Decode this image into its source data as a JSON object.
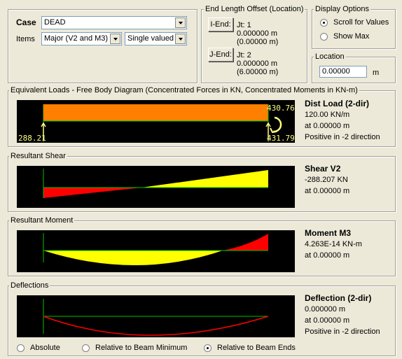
{
  "case": {
    "label": "Case",
    "value": "DEAD"
  },
  "items": {
    "label": "Items",
    "value": "Major (V2 and M3)",
    "mode": "Single valued"
  },
  "end_offset": {
    "title": "End Length Offset (Location)",
    "i_end": {
      "button": "I-End:",
      "joint": "Jt:  1",
      "offset": "0.000000 m",
      "location": "(0.00000 m)"
    },
    "j_end": {
      "button": "J-End:",
      "joint": "Jt:  2",
      "offset": "0.000000 m",
      "location": "(6.00000 m)"
    }
  },
  "display_options": {
    "title": "Display Options",
    "scroll": "Scroll for Values",
    "show_max": "Show Max"
  },
  "location": {
    "title": "Location",
    "value": "0.00000",
    "unit": "m"
  },
  "fbd": {
    "title": "Equivalent Loads - Free Body Diagram  (Concentrated Forces in KN, Concentrated Moments in KN-m)",
    "left_reaction": "288.21",
    "right_moment": "430.76",
    "right_reaction": "431.79",
    "info": [
      "Dist Load (2-dir)",
      "120.00 KN/m",
      "at 0.00000 m",
      "Positive in -2 direction"
    ]
  },
  "shear": {
    "title": "Resultant Shear",
    "info": [
      "Shear V2",
      "-288.207 KN",
      "at 0.00000 m"
    ]
  },
  "moment": {
    "title": "Resultant Moment",
    "info": [
      "Moment M3",
      "4.263E-14 KN-m",
      "at 0.00000 m"
    ]
  },
  "deflection": {
    "title": "Deflections",
    "info": [
      "Deflection (2-dir)",
      "0.000000 m",
      "at 0.00000 m",
      "Positive in -2 direction"
    ],
    "options": [
      "Absolute",
      "Relative to Beam Minimum",
      "Relative to Beam Ends"
    ]
  },
  "colors": {
    "load": "#ff8000",
    "positive": "#ffff00",
    "negative": "#ff0000",
    "axis": "#00c000",
    "reaction": "#ffff80"
  }
}
